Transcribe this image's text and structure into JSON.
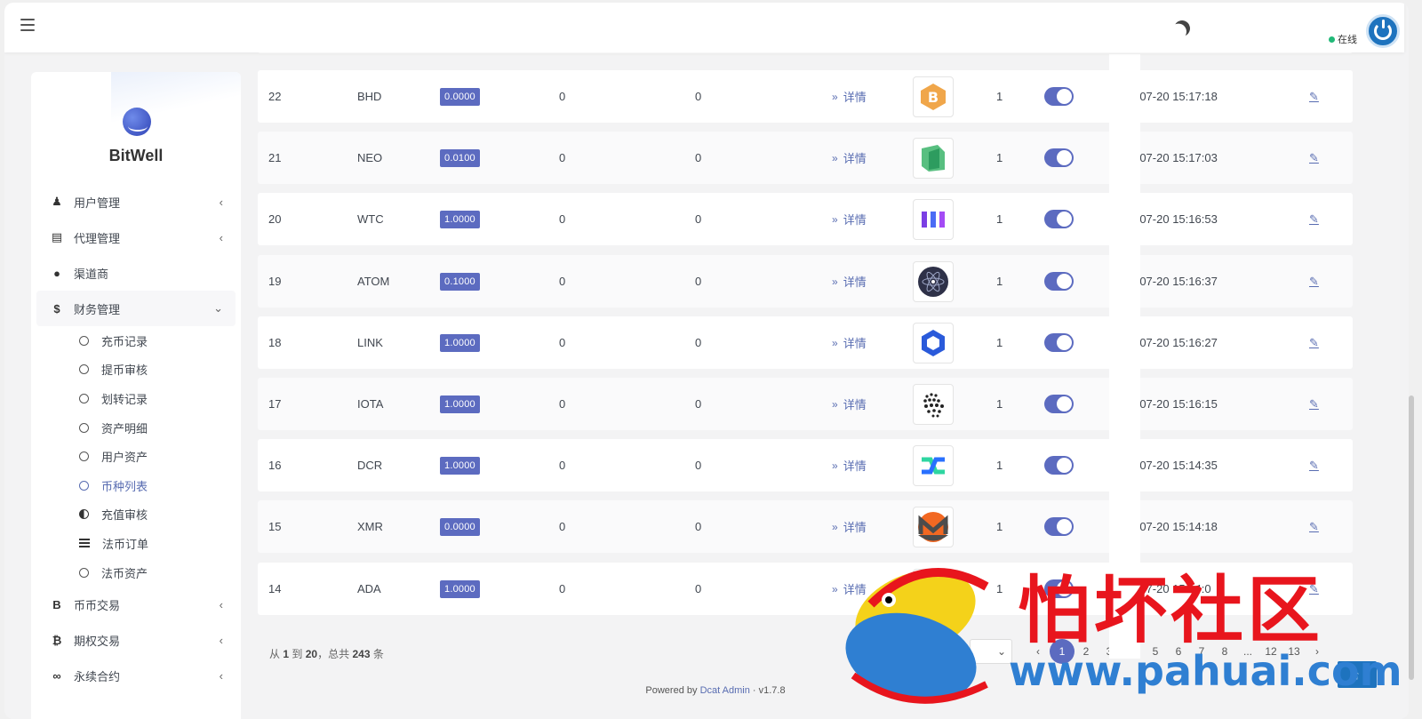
{
  "navbar": {
    "status_label": "在线"
  },
  "brand": {
    "name": "BitWell"
  },
  "sidebar": {
    "menu": [
      {
        "label": "用户管理",
        "icon": "user-tie-icon",
        "expandable": true
      },
      {
        "label": "代理管理",
        "icon": "id-card-icon",
        "expandable": true
      },
      {
        "label": "渠道商",
        "icon": "user-circle-icon",
        "expandable": false
      },
      {
        "label": "财务管理",
        "icon": "dollar-icon",
        "expandable": true,
        "expanded": true
      }
    ],
    "submenu": [
      {
        "label": "充币记录",
        "icon": "circle-icon"
      },
      {
        "label": "提币审核",
        "icon": "circle-icon"
      },
      {
        "label": "划转记录",
        "icon": "circle-icon"
      },
      {
        "label": "资产明细",
        "icon": "circle-icon"
      },
      {
        "label": "用户资产",
        "icon": "circle-icon"
      },
      {
        "label": "币种列表",
        "icon": "circle-icon",
        "current": true
      },
      {
        "label": "充值审核",
        "icon": "half-circle-icon"
      },
      {
        "label": "法币订单",
        "icon": "list-icon"
      },
      {
        "label": "法币资产",
        "icon": "circle-icon"
      }
    ],
    "menu_bottom": [
      {
        "label": "币币交易",
        "icon": "bold-b-icon",
        "glyph": "B"
      },
      {
        "label": "期权交易",
        "icon": "bitcoin-icon",
        "glyph": "₿"
      },
      {
        "label": "永续合约",
        "icon": "link-icon",
        "glyph": "∞"
      }
    ]
  },
  "table": {
    "detail_label": "详情",
    "rows": [
      {
        "id": "22",
        "name": "BHD",
        "rate": "0.0000",
        "a": "0",
        "b": "0",
        "coin_icon": "bhd-coin-icon",
        "num": "1",
        "enabled": true,
        "time": "-07-20 15:17:18"
      },
      {
        "id": "21",
        "name": "NEO",
        "rate": "0.0100",
        "a": "0",
        "b": "0",
        "coin_icon": "neo-coin-icon",
        "num": "1",
        "enabled": true,
        "time": "-07-20 15:17:03"
      },
      {
        "id": "20",
        "name": "WTC",
        "rate": "1.0000",
        "a": "0",
        "b": "0",
        "coin_icon": "wtc-coin-icon",
        "num": "1",
        "enabled": true,
        "time": "-07-20 15:16:53"
      },
      {
        "id": "19",
        "name": "ATOM",
        "rate": "0.1000",
        "a": "0",
        "b": "0",
        "coin_icon": "atom-coin-icon",
        "num": "1",
        "enabled": true,
        "time": "-07-20 15:16:37"
      },
      {
        "id": "18",
        "name": "LINK",
        "rate": "1.0000",
        "a": "0",
        "b": "0",
        "coin_icon": "link-coin-icon",
        "num": "1",
        "enabled": true,
        "time": "-07-20 15:16:27"
      },
      {
        "id": "17",
        "name": "IOTA",
        "rate": "1.0000",
        "a": "0",
        "b": "0",
        "coin_icon": "iota-coin-icon",
        "num": "1",
        "enabled": true,
        "time": "-07-20 15:16:15"
      },
      {
        "id": "16",
        "name": "DCR",
        "rate": "1.0000",
        "a": "0",
        "b": "0",
        "coin_icon": "dcr-coin-icon",
        "num": "1",
        "enabled": true,
        "time": "-07-20 15:14:35"
      },
      {
        "id": "15",
        "name": "XMR",
        "rate": "0.0000",
        "a": "0",
        "b": "0",
        "coin_icon": "xmr-coin-icon",
        "num": "1",
        "enabled": true,
        "time": "-07-20 15:14:18"
      },
      {
        "id": "14",
        "name": "ADA",
        "rate": "1.0000",
        "a": "0",
        "b": "0",
        "coin_icon": "ada-coin-icon",
        "num": "1",
        "enabled": true,
        "time": "-07-20 15:14:0"
      }
    ]
  },
  "pagination": {
    "summary_prefix": "从",
    "from": "1",
    "summary_to": "到",
    "to": "20",
    "summary_total_prefix": "，总共",
    "total": "243",
    "summary_suffix": "条",
    "per_page": "",
    "prev": "‹",
    "pages": [
      "1",
      "2",
      "3",
      "4",
      "5",
      "6",
      "7",
      "8",
      "...",
      "12",
      "13"
    ],
    "current_page": "1",
    "next": "›"
  },
  "footer": {
    "prefix": "Powered by",
    "link": "Dcat Admin",
    "sep": "·",
    "version": "v1.7.8"
  },
  "scroll_top_label": "↑",
  "watermark": {
    "text": "怕坏社区",
    "url": "www.pahuai.com"
  },
  "colors": {
    "accent": "#5c6bc0",
    "link": "#586cb1",
    "online": "#21b978",
    "avatar": "#1e73be"
  }
}
